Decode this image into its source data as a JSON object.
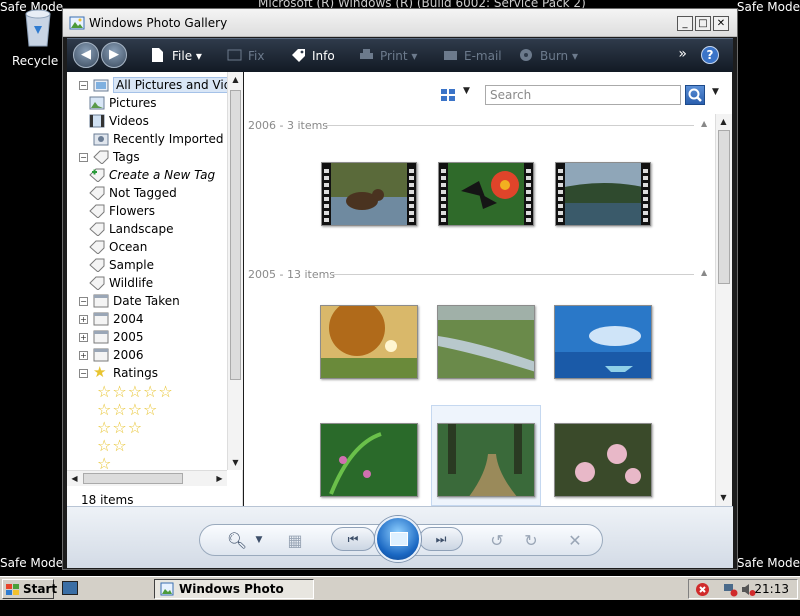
{
  "desktop": {
    "safe_mode_label": "Safe Mode",
    "top_title": "Microsoft (R) Windows (R) (Build 6002: Service Pack 2)",
    "recycle_bin_label": "Recycle Bin"
  },
  "window": {
    "title": "Windows Photo Gallery",
    "controls": {
      "minimize": "_",
      "maximize": "□",
      "close": "✕"
    }
  },
  "toolbar": {
    "items": [
      {
        "label": "File",
        "icon": "file-icon",
        "enabled": true
      },
      {
        "label": "Fix",
        "icon": "fix-icon",
        "enabled": false
      },
      {
        "label": "Info",
        "icon": "info-tag-icon",
        "enabled": true
      },
      {
        "label": "Print",
        "icon": "print-icon",
        "enabled": false
      },
      {
        "label": "E-mail",
        "icon": "email-icon",
        "enabled": false
      },
      {
        "label": "Burn",
        "icon": "burn-icon",
        "enabled": false
      }
    ],
    "more": "»",
    "help": "?"
  },
  "navigation": {
    "tree": [
      {
        "label": "All Pictures and Videos",
        "level": 0,
        "expander": "−",
        "selected": true
      },
      {
        "label": "Pictures",
        "level": 1
      },
      {
        "label": "Videos",
        "level": 1
      },
      {
        "label": "Recently Imported",
        "level": 0
      },
      {
        "label": "Tags",
        "level": 0,
        "expander": "−"
      },
      {
        "label": "Create a New Tag",
        "level": 1,
        "italic": true
      },
      {
        "label": "Not Tagged",
        "level": 1
      },
      {
        "label": "Flowers",
        "level": 1
      },
      {
        "label": "Landscape",
        "level": 1
      },
      {
        "label": "Ocean",
        "level": 1
      },
      {
        "label": "Sample",
        "level": 1
      },
      {
        "label": "Wildlife",
        "level": 1
      },
      {
        "label": "Date Taken",
        "level": 0,
        "expander": "−"
      },
      {
        "label": "2004",
        "level": 1,
        "expander": "+"
      },
      {
        "label": "2005",
        "level": 1,
        "expander": "+"
      },
      {
        "label": "2006",
        "level": 1,
        "expander": "+"
      },
      {
        "label": "Ratings",
        "level": 0,
        "expander": "−"
      }
    ],
    "ratings": [
      5,
      4,
      3,
      2,
      1
    ],
    "items_count": "18 items"
  },
  "main": {
    "search_placeholder": "Search",
    "groups": [
      {
        "header": "2006 - 3 items",
        "thumbs": [
          "bear-video",
          "butterfly-video",
          "lake-video"
        ]
      },
      {
        "header": "2005 - 13 items",
        "thumbs": [
          "autumn-tree",
          "stream",
          "blue-ocean",
          "green-ferns",
          "forest-path",
          "pink-flowers"
        ]
      }
    ]
  },
  "colors": {
    "toolbar_dark": "#1c2430",
    "accent_blue": "#2a5fae",
    "selection": "#d9e6f6"
  },
  "taskbar": {
    "start_label": "Start",
    "task_label": "Windows Photo Gallery",
    "clock": "21:13"
  }
}
